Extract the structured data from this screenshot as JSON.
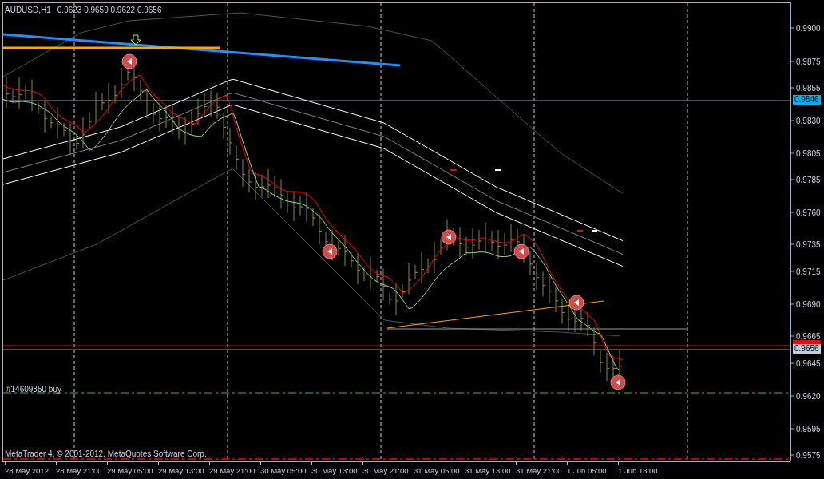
{
  "chart_header": {
    "symbol": "AUDUSD,H1",
    "quote": "0.9623 0.9659 0.9622 0.9656"
  },
  "order_label": "#14609850 buy",
  "copyright": "MetaTrader 4, © 2001-2012, MetaQuotes Software Corp.",
  "price_axis": {
    "labels": [
      "0.9900",
      "0.9875",
      "0.9855",
      "0.9830",
      "0.9805",
      "0.9785",
      "0.9760",
      "0.9735",
      "0.9715",
      "0.9690",
      "0.9665",
      "0.9645",
      "0.9620",
      "0.9595",
      "0.9575"
    ],
    "tags": [
      {
        "kind": "level",
        "text": "0.9846"
      },
      {
        "kind": "bid",
        "text": "0.9656"
      }
    ]
  },
  "time_axis": {
    "labels": [
      "28 May 2012",
      "28 May 21:00",
      "29 May 05:00",
      "29 May 13:00",
      "29 May 21:00",
      "30 May 05:00",
      "30 May 13:00",
      "30 May 21:00",
      "31 May 05:00",
      "31 May 13:00",
      "31 May 21:00",
      "1 Jun 05:00",
      "1 Jun 13:00"
    ]
  }
}
